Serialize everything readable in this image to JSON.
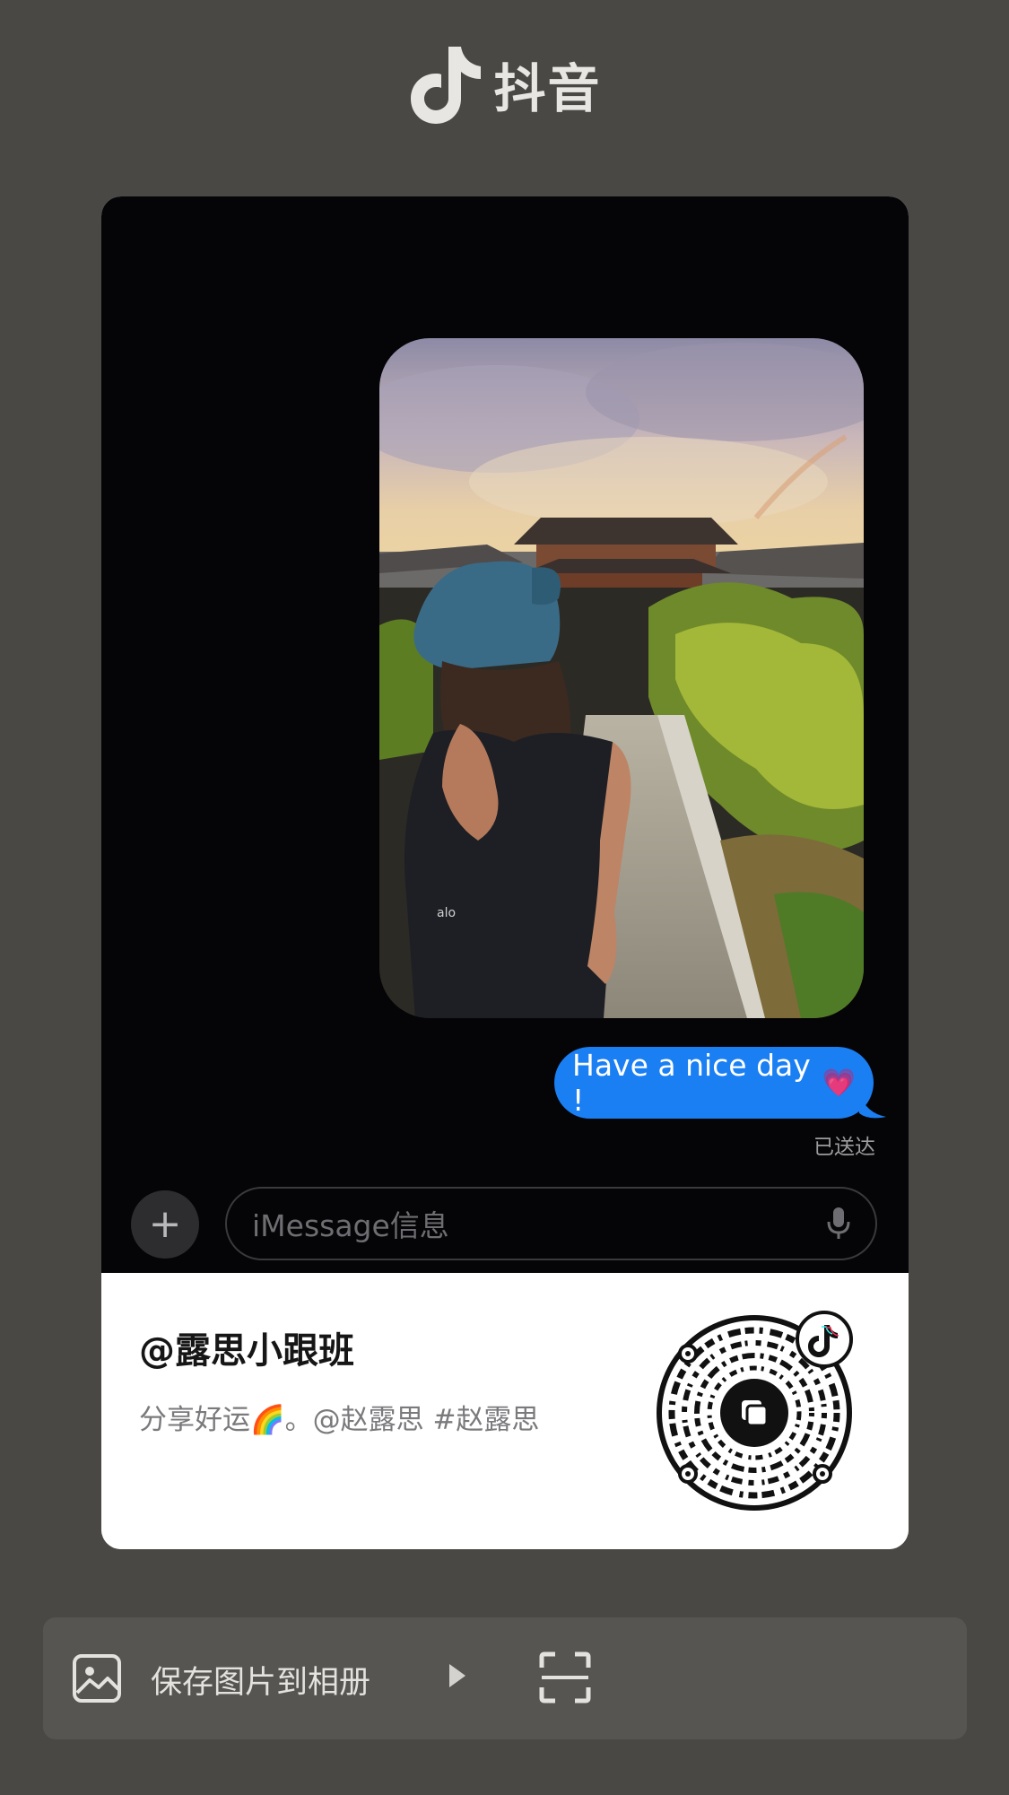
{
  "app": {
    "name": "抖音"
  },
  "card": {
    "message_text": "Have a nice day !",
    "message_emoji": "💗",
    "delivered_label": "已送达",
    "input_placeholder": "iMessage信息",
    "plus_label": "+",
    "author": "@露思小跟班",
    "caption": "分享好运🌈。@赵露思 #赵露思"
  },
  "actions": {
    "save_label": "保存图片到相册"
  },
  "icons": {
    "logo": "douyin-note-icon",
    "save": "image-icon",
    "play": "play-triangle-icon",
    "scan": "scan-icon",
    "mic": "microphone-icon",
    "qr": "qr-code"
  },
  "colors": {
    "background": "#4a4845",
    "bubble": "#1a7ff3",
    "card_media": "#050507"
  }
}
